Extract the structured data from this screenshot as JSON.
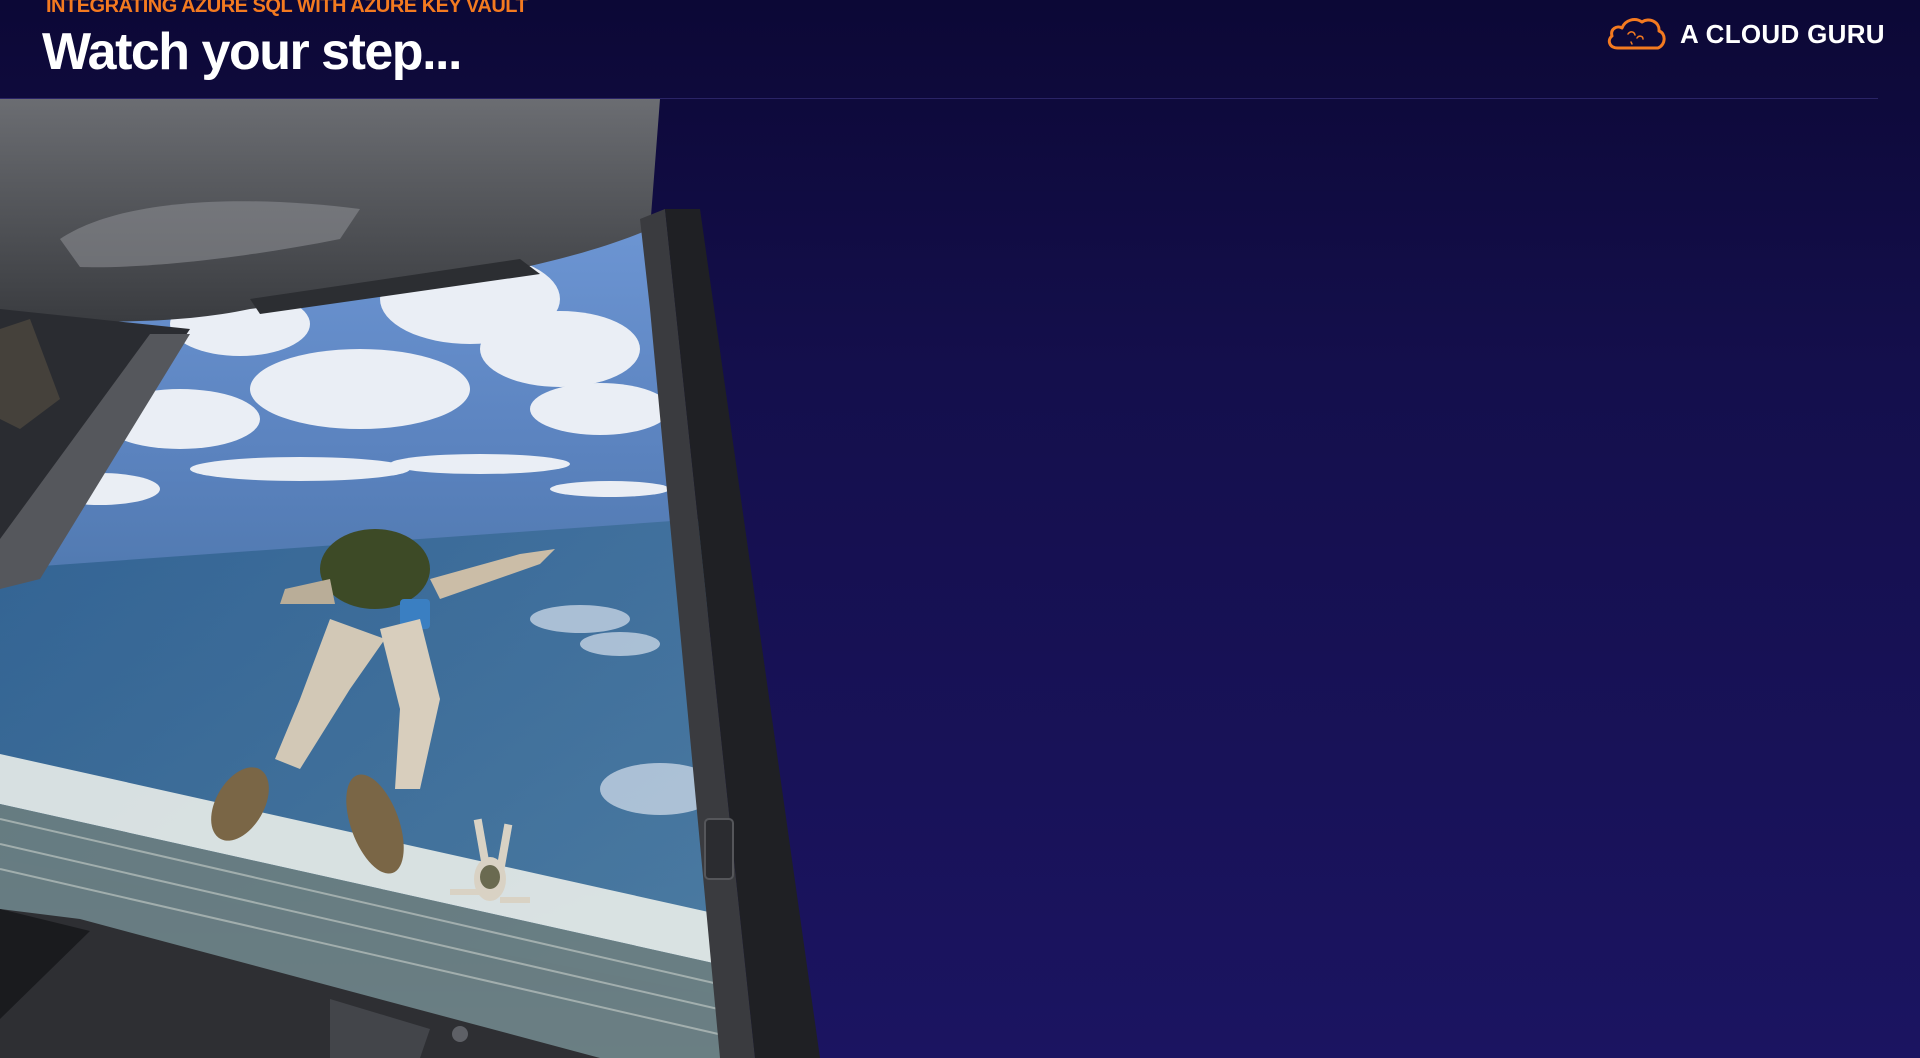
{
  "slide": {
    "eyebrow": "INTEGRATING AZURE SQL WITH AZURE KEY VAULT",
    "title": "Watch your step..."
  },
  "brand": {
    "name": "A CLOUD GURU",
    "icon": "cloud-icon",
    "accent_color": "#f47a20"
  },
  "photo": {
    "subject": "skydiving-photo"
  },
  "colors": {
    "background": "#140f4c",
    "title": "#ffffff",
    "eyebrow": "#f47a20"
  }
}
